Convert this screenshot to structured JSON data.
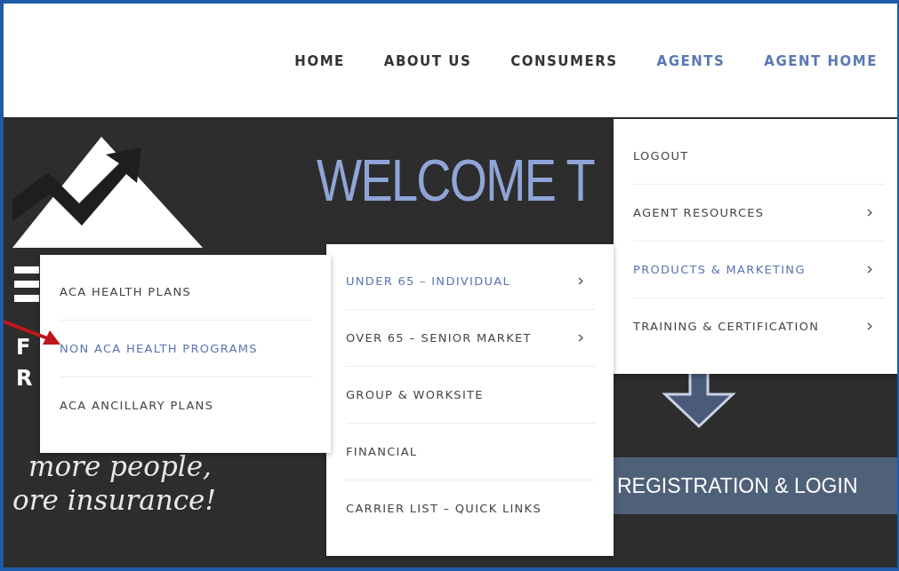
{
  "nav": [
    {
      "label": "HOME",
      "highlighted": false
    },
    {
      "label": "ABOUT US",
      "highlighted": false
    },
    {
      "label": "CONSUMERS",
      "highlighted": false
    },
    {
      "label": "AGENTS",
      "highlighted": true
    },
    {
      "label": "AGENT HOME",
      "highlighted": true
    }
  ],
  "hero": {
    "welcome": "WELCOME T",
    "logo_letters": [
      "F",
      "R"
    ],
    "tagline": [
      "more people,",
      "ore insurance!"
    ],
    "registration_button": "REGISTRATION & LOGIN"
  },
  "menus": [
    {
      "items": [
        {
          "label": "LOGOUT",
          "highlighted": false,
          "has_submenu": false
        },
        {
          "label": "AGENT RESOURCES",
          "highlighted": false,
          "has_submenu": true
        },
        {
          "label": "PRODUCTS & MARKETING",
          "highlighted": true,
          "has_submenu": true
        },
        {
          "label": "TRAINING & CERTIFICATION",
          "highlighted": false,
          "has_submenu": true
        }
      ]
    },
    {
      "items": [
        {
          "label": "UNDER 65 – INDIVIDUAL",
          "highlighted": true,
          "has_submenu": true
        },
        {
          "label": "OVER 65 – SENIOR MARKET",
          "highlighted": false,
          "has_submenu": true
        },
        {
          "label": "GROUP & WORKSITE",
          "highlighted": false,
          "has_submenu": false
        },
        {
          "label": "FINANCIAL",
          "highlighted": false,
          "has_submenu": false
        },
        {
          "label": "CARRIER LIST – QUICK LINKS",
          "highlighted": false,
          "has_submenu": false
        }
      ]
    },
    {
      "items": [
        {
          "label": "ACA HEALTH PLANS",
          "highlighted": false,
          "has_submenu": false
        },
        {
          "label": "NON ACA HEALTH PROGRAMS",
          "highlighted": true,
          "has_submenu": false
        },
        {
          "label": "ACA ANCILLARY PLANS",
          "highlighted": false,
          "has_submenu": false
        }
      ]
    }
  ]
}
